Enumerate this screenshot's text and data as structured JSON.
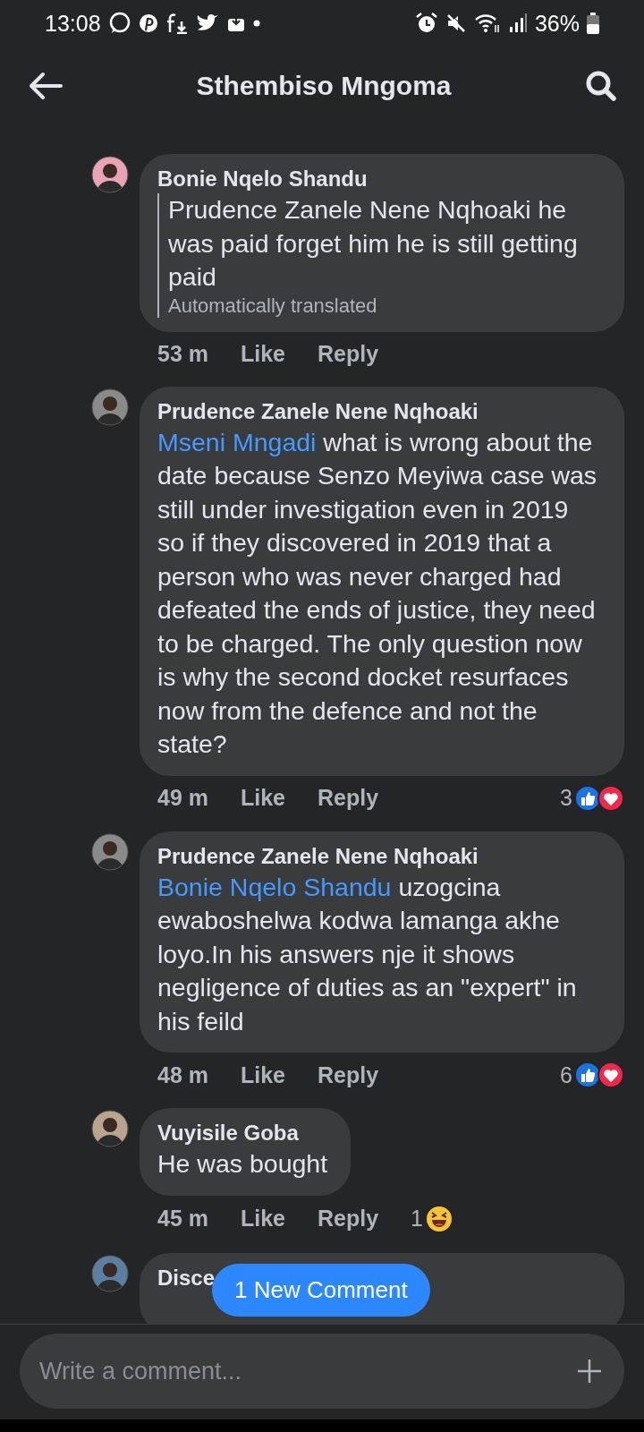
{
  "status_bar": {
    "time": "13:08",
    "battery": "36%"
  },
  "header": {
    "title": "Sthembiso Mngoma"
  },
  "comments": [
    {
      "author": "Bonie Nqelo Shandu",
      "quoted": true,
      "text": "Prudence Zanele Nene Nqhoaki he was paid forget him he is still getting paid",
      "note": "Automatically translated",
      "time": "53 m",
      "like": "Like",
      "reply": "Reply"
    },
    {
      "author": "Prudence Zanele Nene Nqhoaki",
      "quoted": false,
      "mention": "Mseni Mngadi",
      "text": " what is wrong about the date because Senzo Meyiwa case was still under investigation even in 2019 so if they discovered in 2019 that a person who was never charged had defeated the ends of justice, they need to be charged. The only question now is why the second docket resurfaces now from the defence and not the state?",
      "time": "49 m",
      "like": "Like",
      "reply": "Reply",
      "reaction_count": "3",
      "reactions": [
        {
          "kind": "like"
        },
        {
          "kind": "love"
        }
      ]
    },
    {
      "author": "Prudence Zanele Nene Nqhoaki",
      "quoted": false,
      "mention": "Bonie Nqelo Shandu",
      "text": " uzogcina ewaboshelwa kodwa lamanga akhe loyo.In his answers nje it shows negligence of duties as an \"expert\" in his feild",
      "time": "48 m",
      "like": "Like",
      "reply": "Reply",
      "reaction_count": "6",
      "reactions": [
        {
          "kind": "like"
        },
        {
          "kind": "love"
        }
      ]
    },
    {
      "author": "Vuyisile Goba",
      "quoted": false,
      "text": "He was bought",
      "time": "45 m",
      "like": "Like",
      "reply": "Reply",
      "reaction_count": "1",
      "reactions": [
        {
          "kind": "haha"
        }
      ]
    },
    {
      "author": "Disce",
      "quoted": false
    }
  ],
  "new_comment_banner": "1 New Comment",
  "composer": {
    "placeholder": "Write a comment..."
  }
}
